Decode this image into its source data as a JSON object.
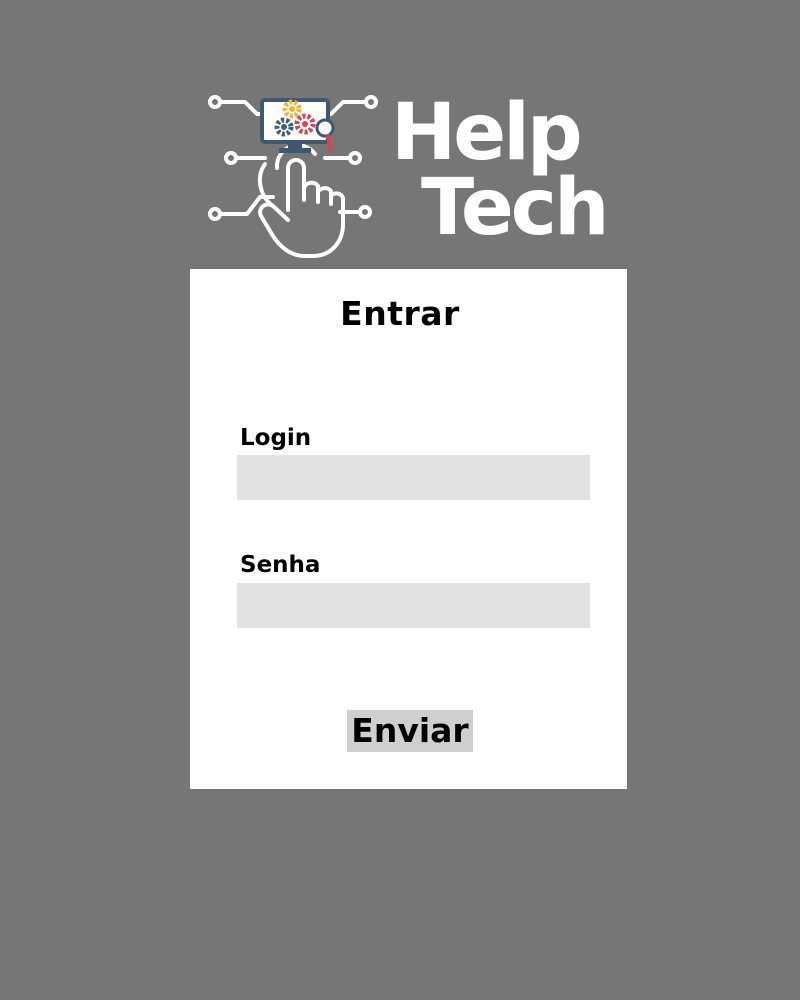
{
  "logo": {
    "line1": "Help",
    "line2": "Tech",
    "icon": "hand-pointer-monitor-gears-icon",
    "colors": {
      "text": "#ffffff",
      "gear_yellow": "#f2b233",
      "gear_blue": "#3b5f7c",
      "gear_red": "#d9434b",
      "monitor": "#3d5870"
    }
  },
  "form": {
    "title": "Entrar",
    "login_label": "Login",
    "login_value": "",
    "senha_label": "Senha",
    "senha_value": "",
    "submit_label": "Enviar"
  },
  "colors": {
    "page_background": "#767676",
    "card_background": "#ffffff",
    "input_background": "#e2e2e2",
    "button_background": "#cfcfcf"
  }
}
